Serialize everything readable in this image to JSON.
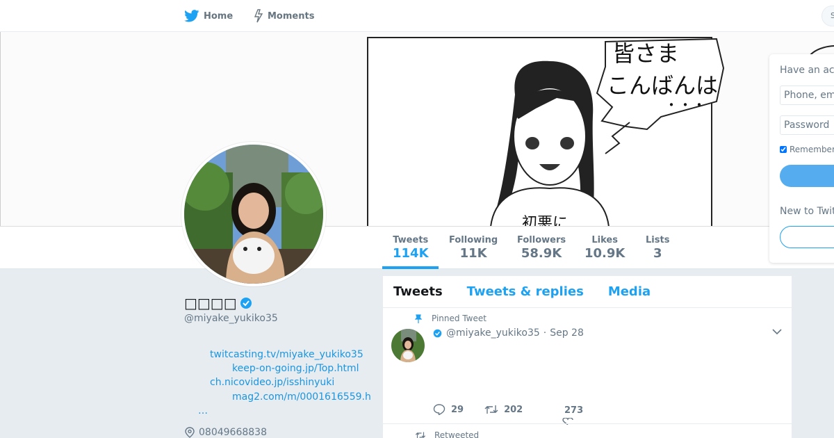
{
  "nav": {
    "home_label": "Home",
    "moments_label": "Moments",
    "search_partial": "S"
  },
  "banner": {
    "speech_line1": "皆さま",
    "speech_line2": "こんばんは",
    "speech_dots": "・・・",
    "shirt_text": "初悪に"
  },
  "stats": [
    {
      "label": "Tweets",
      "value": "114K"
    },
    {
      "label": "Following",
      "value": "11K"
    },
    {
      "label": "Followers",
      "value": "58.9K"
    },
    {
      "label": "Likes",
      "value": "10.9K"
    },
    {
      "label": "Lists",
      "value": "3"
    }
  ],
  "profile": {
    "name": "□□□□",
    "screen_name": "@miyake_yukiko35",
    "links": [
      "twitcasting.tv/miyake_yukiko35",
      "keep-on-going.jp/Top.html",
      "ch.nicovideo.jp/isshinyuki",
      "mag2.com/m/0001616559.h"
    ],
    "more": "…",
    "phone": "08049668838"
  },
  "timeline": {
    "tabs": [
      "Tweets",
      "Tweets & replies",
      "Media"
    ],
    "pinned_label": "Pinned Tweet",
    "tweet": {
      "handle": "@miyake_yukiko35",
      "separator": "·",
      "date": "Sep 28",
      "replies": "29",
      "retweets": "202",
      "likes": "273"
    },
    "retweeted_label": "Retweeted"
  },
  "login": {
    "title": "Have an account?",
    "phone_placeholder": "Phone, email or username",
    "password_placeholder": "Password",
    "remember_label": "Remember me",
    "new_to": "New to Twitter?"
  },
  "colors": {
    "accent": "#1da1f2",
    "link": "#1b95e0",
    "muted": "#657786",
    "background": "#e6ecf0"
  }
}
